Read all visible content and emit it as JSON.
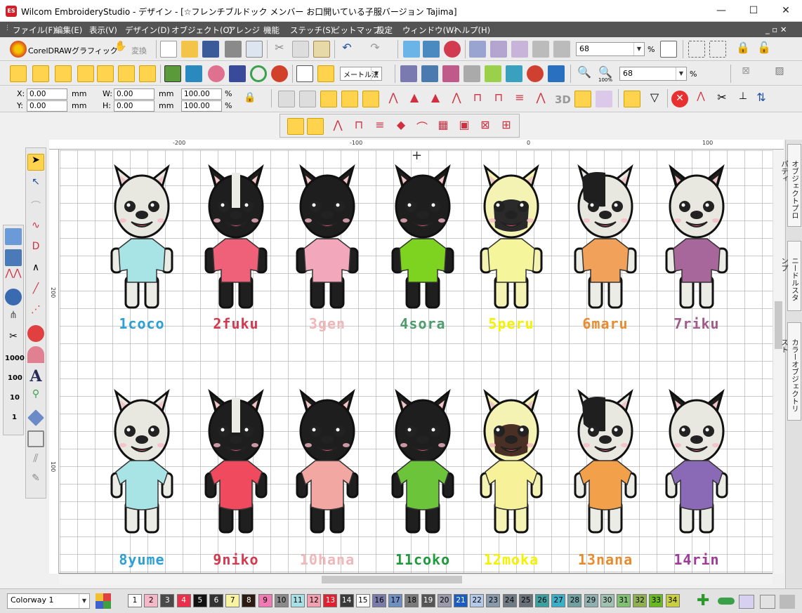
{
  "window": {
    "title": "Wilcom EmbroideryStudio - デザイン - [☆フレンチブルドック メンバー お口開いている子服バージョン       Tajima]",
    "app_icon": "ES",
    "controls": {
      "minimize": "—",
      "maximize": "☐",
      "close": "✕"
    }
  },
  "menubar": {
    "items": [
      "ファイル(F)",
      "編集(E)",
      "表示(V)",
      "デザイン(D)",
      "オブジェクト(O)",
      "アレンジ",
      "機能",
      "ステッチ(S)",
      "ビットマップ",
      "設定",
      "ウィンドウ(W)",
      "ヘルプ(H)"
    ],
    "mdi_controls": "_ ▫ ✕"
  },
  "toolbar1": {
    "coreldraw_label": "CorelDRAWグラフィック",
    "convert_label": "変換",
    "zoom_value": "68",
    "zoom_unit": "%"
  },
  "toolbar2": {
    "units_value": "メートル法",
    "zoom_value": "68",
    "zoom_unit": "%",
    "zoom_100_label": "100%"
  },
  "toolbar3": {
    "x_label": "X:",
    "x_value": "0.00",
    "x_unit": "mm",
    "y_label": "Y:",
    "y_value": "0.00",
    "y_unit": "mm",
    "w_label": "W:",
    "w_value": "0.00",
    "w_unit": "mm",
    "h_label": "H:",
    "h_value": "0.00",
    "h_unit": "mm",
    "sx_value": "100.00",
    "sx_unit": "%",
    "sy_value": "100.00",
    "sy_unit": "%",
    "stitch_3d_label": "3D"
  },
  "ruler": {
    "h_labels": [
      "-200",
      "-100",
      "0",
      "100"
    ],
    "v_labels": [
      "200",
      "100"
    ]
  },
  "dock_tabs": [
    "オブジェクトプロパティ",
    "ニードルスタンプ",
    "カラーオブジェクトリスト"
  ],
  "left_tools": {
    "count_1000": "1000",
    "count_100": "100",
    "count_10": "10",
    "count_1": "1"
  },
  "dogs_row1": [
    {
      "label": "1coco",
      "color": "#2c9fd6",
      "shirt": "#a8e3e6",
      "head": "#e8e8e0",
      "patch": "none"
    },
    {
      "label": "2fuku",
      "color": "#d23a4f",
      "shirt": "#ef6178",
      "head": "#1e1e1e",
      "patch": "blaze"
    },
    {
      "label": "3gen",
      "color": "#f0b6b8",
      "shirt": "#f2a7bb",
      "head": "#1e1e1e",
      "patch": "none"
    },
    {
      "label": "4sora",
      "color": "#4c9c6c",
      "shirt": "#7ed321",
      "head": "#1e1e1e",
      "patch": "none"
    },
    {
      "label": "5peru",
      "color": "#f5f200",
      "shirt": "#f5f59c",
      "head": "#f5f3b4",
      "patch": "mask"
    },
    {
      "label": "6maru",
      "color": "#e98b2c",
      "shirt": "#f2a15a",
      "head": "#e8e8e0",
      "patch": "half"
    },
    {
      "label": "7riku",
      "color": "#a05b8a",
      "shirt": "#a7679a",
      "head": "#e8e8e0",
      "patch": "ears"
    }
  ],
  "dogs_row2": [
    {
      "label": "8yume",
      "color": "#2c9fd6",
      "shirt": "#a8e3e6",
      "head": "#e8e8e0",
      "patch": "none"
    },
    {
      "label": "9niko",
      "color": "#d23a4f",
      "shirt": "#ef4a5e",
      "head": "#1e1e1e",
      "patch": "blaze"
    },
    {
      "label": "10hana",
      "color": "#f0b6b8",
      "shirt": "#f2a7a3",
      "head": "#1e1e1e",
      "patch": "none"
    },
    {
      "label": "11coko",
      "color": "#1e9a3c",
      "shirt": "#6cc43a",
      "head": "#1e1e1e",
      "patch": "none"
    },
    {
      "label": "12moka",
      "color": "#f5f200",
      "shirt": "#f7f29a",
      "head": "#f5f3b4",
      "patch": "mask"
    },
    {
      "label": "13nana",
      "color": "#e98b2c",
      "shirt": "#f2a04a",
      "head": "#e8e8e0",
      "patch": "half"
    },
    {
      "label": "14rin",
      "color": "#a03a9a",
      "shirt": "#8a6ab7",
      "head": "#e8e8e0",
      "patch": "ears"
    }
  ],
  "statusbar": {
    "colorway_value": "Colorway 1",
    "swatches": [
      {
        "n": "1",
        "c": "#ffffff"
      },
      {
        "n": "2",
        "c": "#f4b8c8"
      },
      {
        "n": "3",
        "c": "#4a4a4a"
      },
      {
        "n": "4",
        "c": "#e8304a"
      },
      {
        "n": "5",
        "c": "#111111"
      },
      {
        "n": "6",
        "c": "#333333"
      },
      {
        "n": "7",
        "c": "#f8f4a0"
      },
      {
        "n": "8",
        "c": "#2b1a12"
      },
      {
        "n": "9",
        "c": "#f07ab4"
      },
      {
        "n": "10",
        "c": "#8a8a8a"
      },
      {
        "n": "11",
        "c": "#a8e0e8"
      },
      {
        "n": "12",
        "c": "#f0a0b0"
      },
      {
        "n": "13",
        "c": "#e02030"
      },
      {
        "n": "14",
        "c": "#3a3a3a"
      },
      {
        "n": "15",
        "c": "#ffffff"
      },
      {
        "n": "16",
        "c": "#7b7baa"
      },
      {
        "n": "17",
        "c": "#6e8fc0"
      },
      {
        "n": "18",
        "c": "#7a7a7a"
      },
      {
        "n": "19",
        "c": "#555555"
      },
      {
        "n": "20",
        "c": "#9a9aaa"
      },
      {
        "n": "21",
        "c": "#1a5cc0"
      },
      {
        "n": "22",
        "c": "#b4c8e8"
      },
      {
        "n": "23",
        "c": "#8899aa"
      },
      {
        "n": "24",
        "c": "#707a84"
      },
      {
        "n": "25",
        "c": "#6a7078"
      },
      {
        "n": "26",
        "c": "#3aa0a0"
      },
      {
        "n": "27",
        "c": "#3ab0c8"
      },
      {
        "n": "28",
        "c": "#70a0a0"
      },
      {
        "n": "29",
        "c": "#90b0b0"
      },
      {
        "n": "30",
        "c": "#a0c0b0"
      },
      {
        "n": "31",
        "c": "#80c070"
      },
      {
        "n": "32",
        "c": "#90b050"
      },
      {
        "n": "33",
        "c": "#6ab820"
      },
      {
        "n": "34",
        "c": "#c8d040"
      }
    ]
  }
}
